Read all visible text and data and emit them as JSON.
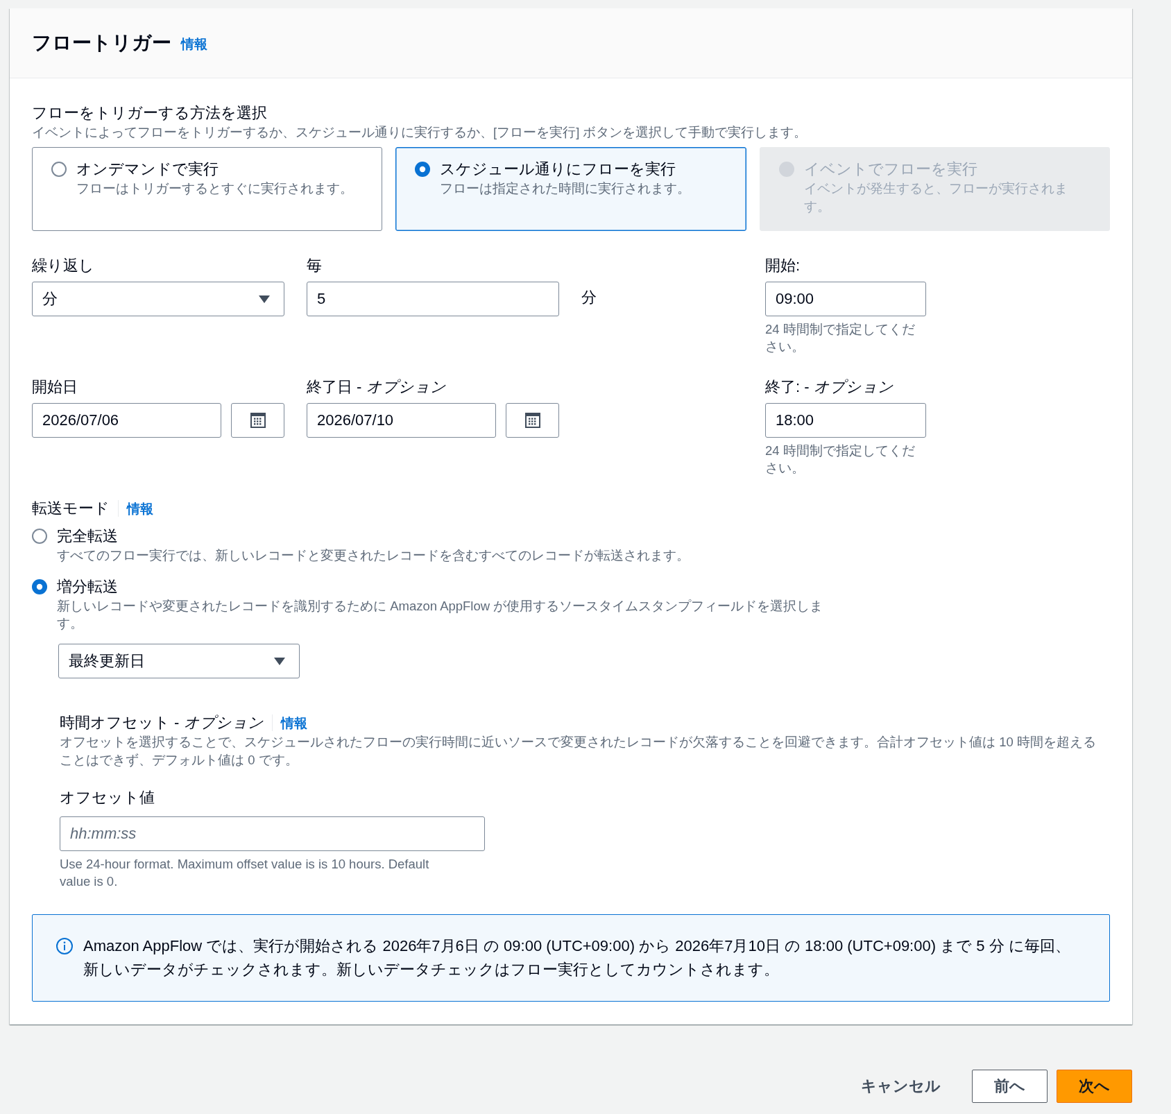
{
  "header": {
    "title": "フロートリガー",
    "info_link": "情報"
  },
  "trigger": {
    "label": "フローをトリガーする方法を選択",
    "description": "イベントによってフローをトリガーするか、スケジュール通りに実行するか、[フローを実行] ボタンを選択して手動で実行します。",
    "options": [
      {
        "title": "オンデマンドで実行",
        "description": "フローはトリガーするとすぐに実行されます。",
        "selected": false,
        "disabled": false
      },
      {
        "title": "スケジュール通りにフローを実行",
        "description": "フローは指定された時間に実行されます。",
        "selected": true,
        "disabled": false
      },
      {
        "title": "イベントでフローを実行",
        "description": "イベントが発生すると、フローが実行されます。",
        "selected": false,
        "disabled": true
      }
    ]
  },
  "schedule": {
    "repeat": {
      "label": "繰り返し",
      "value": "分"
    },
    "every": {
      "label": "毎",
      "value": "5",
      "unit": "分"
    },
    "start_time": {
      "label": "開始:",
      "value": "09:00",
      "hint": "24 時間制で指定してください。"
    },
    "start_date": {
      "label": "開始日",
      "value": "2026/07/06"
    },
    "end_date": {
      "label": "終了日 - *オプション*",
      "value": "2026/07/10"
    },
    "end_time": {
      "label": "終了: - *オプション*",
      "value": "18:00",
      "hint": "24 時間制で指定してください。"
    }
  },
  "transfer_mode": {
    "label": "転送モード",
    "info_link": "情報",
    "options": [
      {
        "label": "完全転送",
        "description": "すべてのフロー実行では、新しいレコードと変更されたレコードを含むすべてのレコードが転送されます。",
        "selected": false
      },
      {
        "label": "増分転送",
        "description": "新しいレコードや変更されたレコードを識別するために Amazon AppFlow が使用するソースタイムスタンプフィールドを選択します。",
        "selected": true
      }
    ],
    "timestamp_field": {
      "value": "最終更新日"
    },
    "time_offset": {
      "label": "時間オフセット - *オプション*",
      "info_link": "情報",
      "description": "オフセットを選択することで、スケジュールされたフローの実行時間に近いソースで変更されたレコードが欠落することを回避できます。合計オフセット値は 10 時間を超えることはできず、デフォルト値は 0 です。",
      "field": {
        "label": "オフセット値",
        "placeholder": "hh:mm:ss",
        "hint": "Use 24-hour format. Maximum offset value is is 10 hours. Default value is 0."
      }
    }
  },
  "notice": {
    "text": "Amazon AppFlow では、実行が開始される 2026年7月6日 の 09:00 (UTC+09:00) から 2026年7月10日 の 18:00 (UTC+09:00) まで 5 分 に毎回、新しいデータがチェックされます。新しいデータチェックはフロー実行としてカウントされます。"
  },
  "footer": {
    "buttons": [
      {
        "label": "キャンセル",
        "kind": "link"
      },
      {
        "label": "前へ",
        "kind": "normal"
      },
      {
        "label": "次へ",
        "kind": "primary"
      }
    ]
  }
}
